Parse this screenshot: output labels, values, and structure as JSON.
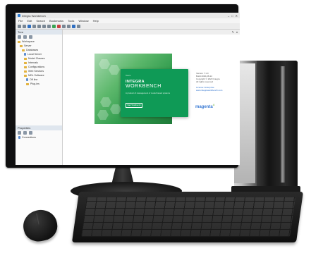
{
  "window": {
    "title": "Integra Workbench",
    "controls": [
      "–",
      "□",
      "✕"
    ]
  },
  "menu": [
    "File",
    "Edit",
    "Search",
    "Bookmarks",
    "Tools",
    "Window",
    "Help"
  ],
  "left_pane": {
    "tree_title": "Tree",
    "tree_items": [
      {
        "label": "Workspace",
        "icon": "folder"
      },
      {
        "label": "Server",
        "icon": "folder"
      },
      {
        "label": "Databases",
        "icon": "folder"
      },
      {
        "label": "Local Server",
        "icon": "db"
      },
      {
        "label": "Model Classes",
        "icon": "folder"
      },
      {
        "label": "Internals",
        "icon": "folder"
      },
      {
        "label": "Configurations",
        "icon": "folder"
      },
      {
        "label": "Web Services",
        "icon": "folder"
      },
      {
        "label": "MDL Software",
        "icon": "folder"
      },
      {
        "label": "Off line",
        "icon": "db"
      },
      {
        "label": "Plug-ins",
        "icon": "folder"
      }
    ],
    "properties_title": "Properties",
    "properties_item": "Connections"
  },
  "splash": {
    "small_text": "Team",
    "brand_line1": "INTEGRA",
    "brand_line2": "WORKBENCH",
    "tagline": "A product of management of model based systems",
    "button_label": "Start Workbench"
  },
  "info_lines": [
    "Version 7.1.0",
    "Build 2020-08-14",
    "Copyright © 2020 Integra",
    "All rights reserved",
    "",
    "License: Enterprise",
    "www.integraworkbench.com"
  ],
  "logo": {
    "text": "magenta",
    "superscript": "4"
  },
  "colors": {
    "splash_green": "#0f9a56",
    "accent_blue": "#2a6fcc"
  }
}
